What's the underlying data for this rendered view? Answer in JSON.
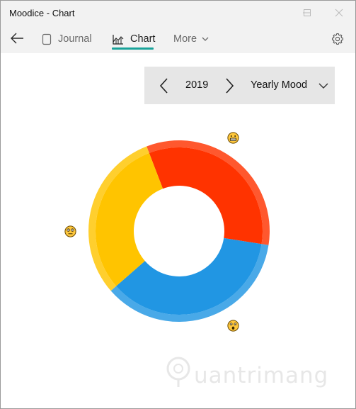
{
  "window": {
    "title": "Moodice - Chart"
  },
  "nav": {
    "back_icon": "back-arrow-icon",
    "items": [
      {
        "label": "Journal",
        "icon": "journal-icon",
        "active": false
      },
      {
        "label": "Chart",
        "icon": "chart-icon",
        "active": true
      },
      {
        "label": "More",
        "icon": "chevron-down-icon",
        "active": false
      }
    ],
    "settings_icon": "gear-icon",
    "accent_color": "#1aa39a"
  },
  "selector": {
    "year": "2019",
    "mode": "Yearly Mood"
  },
  "chart_data": {
    "type": "pie",
    "style": "donut",
    "title": "",
    "slices": [
      {
        "mood": "grinning",
        "value": 33.3,
        "color": "#ff3300"
      },
      {
        "mood": "surprised",
        "value": 36.1,
        "color": "#2196e3"
      },
      {
        "mood": "flushed",
        "value": 30.6,
        "color": "#ffc400"
      }
    ]
  },
  "watermark": {
    "text": "uantrimang"
  }
}
